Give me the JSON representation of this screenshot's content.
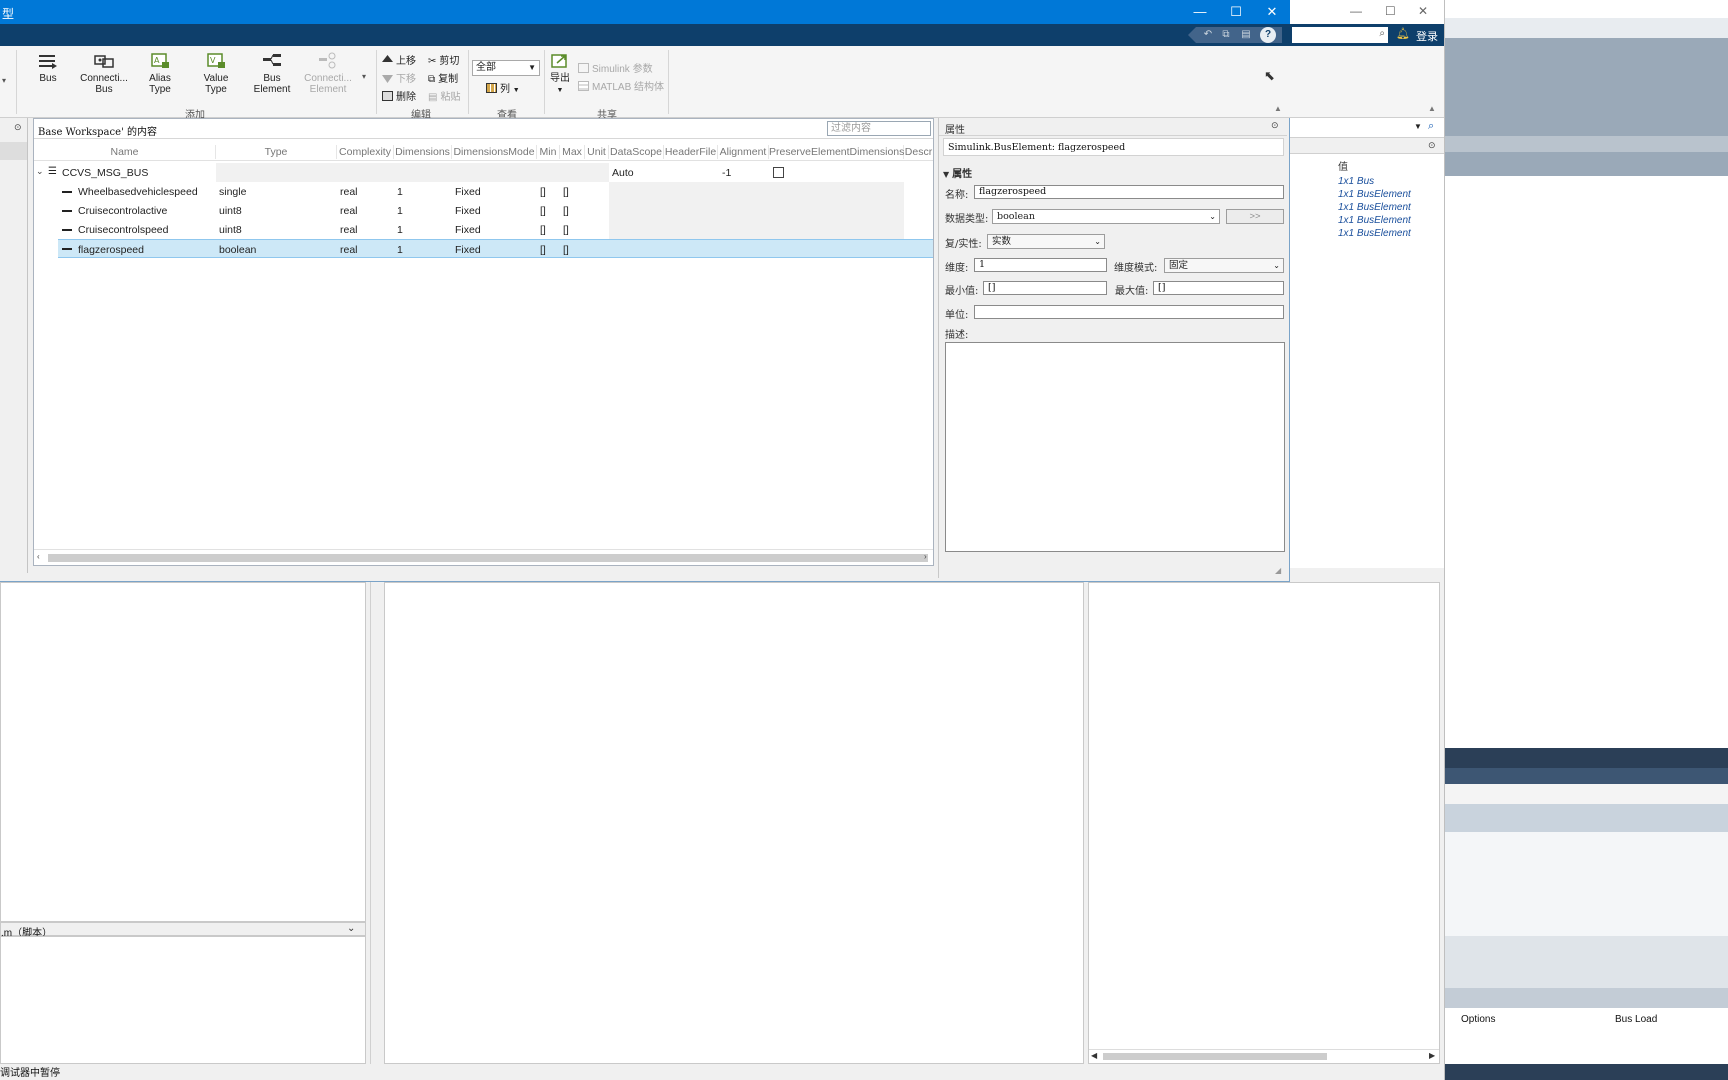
{
  "window": {
    "title": "型",
    "login_label": "登录",
    "controls": {
      "minimize": "—",
      "maximize": "☐",
      "close": "✕"
    },
    "help_label": "?"
  },
  "ribbon": {
    "add_buttons": [
      {
        "line1": "Bus",
        "line2": "",
        "enabled": true
      },
      {
        "line1": "Connecti...",
        "line2": "Bus",
        "enabled": true
      },
      {
        "line1": "Alias",
        "line2": "Type",
        "enabled": true
      },
      {
        "line1": "Value",
        "line2": "Type",
        "enabled": true
      },
      {
        "line1": "Bus",
        "line2": "Element",
        "enabled": true
      },
      {
        "line1": "Connecti...",
        "line2": "Element",
        "enabled": false
      }
    ],
    "group_add": "添加",
    "edit_items": {
      "move_up": "上移",
      "move_down": "下移",
      "delete": "删除",
      "cut": "剪切",
      "copy": "复制",
      "paste": "粘贴"
    },
    "group_edit": "编辑",
    "view_combo": "全部",
    "columns_label": "列",
    "group_view": "查看",
    "export_label": "导出",
    "share_items": {
      "simulink_params": "Simulink 参数",
      "matlab_struct": "MATLAB 结构体"
    },
    "group_share": "共享"
  },
  "workspace": {
    "title": "Base Workspace' 的内容",
    "filter_placeholder": "过滤内容",
    "columns": [
      "Name",
      "Type",
      "Complexity",
      "Dimensions",
      "DimensionsMode",
      "Min",
      "Max",
      "Unit",
      "DataScope",
      "HeaderFile",
      "Alignment",
      "PreserveElementDimensions",
      "Descr"
    ],
    "bus": {
      "name": "CCVS_MSG_BUS",
      "datascope": "Auto",
      "alignment": "-1"
    },
    "rows": [
      {
        "name": "Wheelbasedvehiclespeed",
        "type": "single",
        "complexity": "real",
        "dimensions": "1",
        "mode": "Fixed",
        "min": "[]",
        "max": "[]"
      },
      {
        "name": "Cruisecontrolactive",
        "type": "uint8",
        "complexity": "real",
        "dimensions": "1",
        "mode": "Fixed",
        "min": "[]",
        "max": "[]"
      },
      {
        "name": "Cruisecontrolspeed",
        "type": "uint8",
        "complexity": "real",
        "dimensions": "1",
        "mode": "Fixed",
        "min": "[]",
        "max": "[]"
      },
      {
        "name": "flagzerospeed",
        "type": "boolean",
        "complexity": "real",
        "dimensions": "1",
        "mode": "Fixed",
        "min": "[]",
        "max": "[]"
      }
    ],
    "selected_row": 3
  },
  "properties": {
    "panel_title": "属性",
    "object_label": "Simulink.BusElement: flagzerospeed",
    "section_label": "属性",
    "name_label": "名称:",
    "name_value": "flagzerospeed",
    "datatype_label": "数据类型:",
    "datatype_value": "boolean",
    "datatype_button": ">>",
    "complexity_label": "复/实性:",
    "complexity_value": "实数",
    "dimensions_label": "维度:",
    "dimensions_value": "1",
    "dimmode_label": "维度模式:",
    "dimmode_value": "固定",
    "min_label": "最小值:",
    "min_value": "[]",
    "max_label": "最大值:",
    "max_value": "[]",
    "unit_label": "单位:",
    "unit_value": "",
    "desc_label": "描述:"
  },
  "background": {
    "value_header": "值",
    "values": [
      "1x1 Bus",
      "1x1 BusElement",
      "1x1 BusElement",
      "1x1 BusElement",
      "1x1 BusElement"
    ],
    "script_label": ".m（脚本）",
    "status_text": "调试器中暂停",
    "table_headers": [
      "Options",
      "Bus Load"
    ]
  },
  "colors": {
    "title_bar": "#0078d7",
    "quick_bar": "#0e3f6b",
    "selection": "#cde8f7",
    "value_text": "#1a4f9c"
  }
}
